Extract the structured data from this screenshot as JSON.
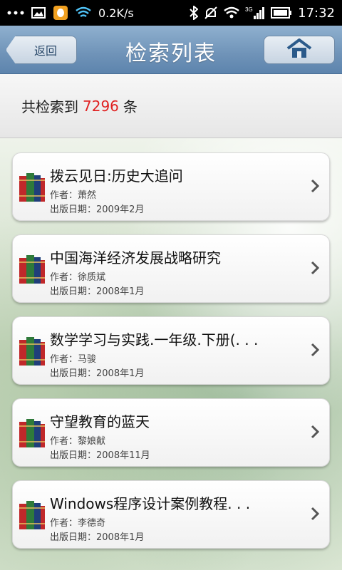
{
  "status_bar": {
    "speed": "0.2K/s",
    "network": "3G",
    "time": "17:32"
  },
  "header": {
    "back_label": "返回",
    "title": "检索列表"
  },
  "summary": {
    "prefix": "共检索到",
    "count": "7296",
    "suffix": "条"
  },
  "results": [
    {
      "title": "拨云见日:历史大追问",
      "author": "作者：萧然",
      "date": "出版日期：2009年2月"
    },
    {
      "title": "中国海洋经济发展战略研究",
      "author": "作者：徐质斌",
      "date": "出版日期：2008年1月"
    },
    {
      "title": "数学学习与实践.一年级.下册(. . .",
      "author": "作者：马骏",
      "date": "出版日期：2008年1月"
    },
    {
      "title": "守望教育的蓝天",
      "author": "作者：黎娘献",
      "date": "出版日期：2008年11月"
    },
    {
      "title": "Windows程序设计案例教程. . .",
      "author": "作者：李德奇",
      "date": "出版日期：2008年1月"
    }
  ],
  "colors": {
    "count_highlight": "#e02020",
    "title_bar": "#7196bb"
  }
}
